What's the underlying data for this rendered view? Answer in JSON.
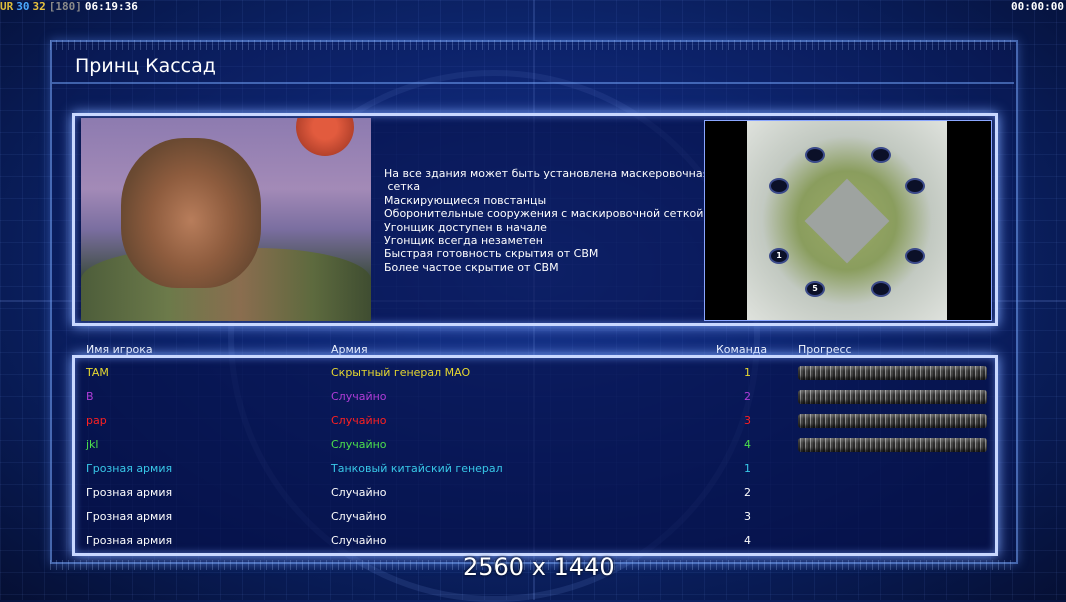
{
  "hud": {
    "left_items": [
      {
        "text": "UR",
        "color": "#dcbc3a"
      },
      {
        "text": "30",
        "color": "#4aa8ff"
      },
      {
        "text": "32",
        "color": "#e7c23f"
      },
      {
        "text": "[180]",
        "color": "#8a8a8a"
      },
      {
        "text": "06:19:36",
        "color": "#ffffff"
      }
    ],
    "right_time": "00:00:00"
  },
  "title": "Принц Кассад",
  "general": {
    "portrait_icon": "prince-kassad-portrait",
    "features": [
      "На все здания может быть установлена маскеровочная",
      " сетка",
      "Маскирующиеся повстанцы",
      "Оборонительные сооружения с маскировочной сеткой",
      "Угонщик доступен в начале",
      "Угонщик всегда незаметен",
      "Быстрая готовность скрытия от СВМ",
      "Более частое скрытие от СВМ"
    ]
  },
  "minimap": {
    "start_labels": [
      "1",
      "5"
    ]
  },
  "table": {
    "headers": {
      "name": "Имя игрока",
      "army": "Армия",
      "team": "Команда",
      "progress": "Прогресс"
    },
    "rows": [
      {
        "name": "TAM",
        "army": "Скрытный генерал MAO",
        "team": "1",
        "color": "#e6d830",
        "has_progress": true
      },
      {
        "name": "B",
        "army": "Случайно",
        "team": "2",
        "color": "#b03cd8",
        "has_progress": true
      },
      {
        "name": "pap",
        "army": "Случайно",
        "team": "3",
        "color": "#ff2020",
        "has_progress": true
      },
      {
        "name": "jkl",
        "army": "Случайно",
        "team": "4",
        "color": "#4ce04c",
        "has_progress": true
      },
      {
        "name": "Грозная армия",
        "army": "Танковый китайский генерал",
        "team": "1",
        "color": "#38c8e8",
        "has_progress": false
      },
      {
        "name": "Грозная армия",
        "army": "Случайно",
        "team": "2",
        "color": "#ffffff",
        "has_progress": false
      },
      {
        "name": "Грозная армия",
        "army": "Случайно",
        "team": "3",
        "color": "#ffffff",
        "has_progress": false
      },
      {
        "name": "Грозная армия",
        "army": "Случайно",
        "team": "4",
        "color": "#ffffff",
        "has_progress": false
      }
    ]
  },
  "resolution_label": "2560 x 1440"
}
